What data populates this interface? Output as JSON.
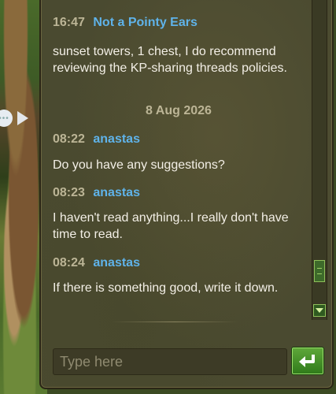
{
  "chat": {
    "messages": [
      {
        "time": "16:47",
        "author": "Not a Pointy Ears",
        "text": "sunset towers, 1 chest, I do recommend reviewing the KP-sharing threads policies."
      },
      {
        "date_separator": "8 Aug 2026"
      },
      {
        "time": "08:22",
        "author": "anastas",
        "text": "Do you have any suggestions?"
      },
      {
        "time": "08:23",
        "author": "anastas",
        "text": "I haven't read anything...I really don't have time to read."
      },
      {
        "time": "08:24",
        "author": "anastas",
        "text": "If there is something good, write it down."
      }
    ],
    "input": {
      "placeholder": "Type here",
      "value": ""
    }
  },
  "colors": {
    "author": "#5fb3ea",
    "time": "#bcb596",
    "message_text": "#f3efe6",
    "send_button": "#4a9a2e"
  },
  "icons": {
    "send": "enter-arrow-icon",
    "scroll_down": "chevron-down-icon",
    "map_nav": "play-arrow-icon"
  }
}
